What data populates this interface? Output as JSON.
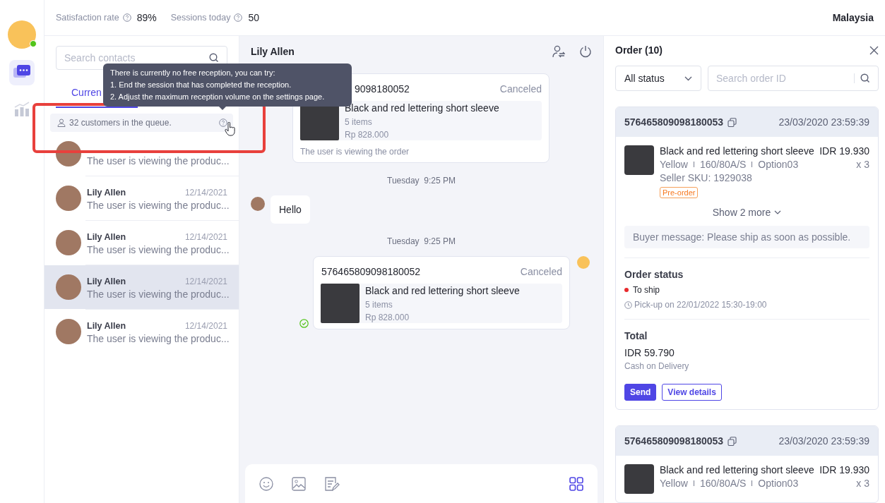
{
  "rail": {
    "agent_online": true,
    "items": [
      {
        "kind": "chat",
        "selected": true
      },
      {
        "kind": "stats",
        "selected": false
      }
    ]
  },
  "top_bar": {
    "stats": [
      {
        "label": "Satisfaction rate",
        "value": "89%"
      },
      {
        "label": "Sessions today",
        "value": "50"
      }
    ],
    "region": "Malaysia"
  },
  "contacts": {
    "search_placeholder": "Search contacts",
    "tabs": [
      {
        "label": "Curren",
        "selected": true
      }
    ],
    "queue": "32 customers in the queue.",
    "items": [
      {
        "preview": "The user is viewing the produc...",
        "selected": false
      },
      {
        "name": "Lily Allen",
        "date": "12/14/2021",
        "preview": "The user is viewing the produc...",
        "selected": false
      },
      {
        "name": "Lily Allen",
        "date": "12/14/2021",
        "preview": "The user is viewing the produc...",
        "selected": false
      },
      {
        "name": "Lily Allen",
        "date": "12/14/2021",
        "preview": "The user is viewing the produc...",
        "selected": true
      },
      {
        "name": "Lily Allen",
        "date": "12/14/2021",
        "preview": "The user is viewing the produc...",
        "selected": false
      }
    ]
  },
  "tooltip": {
    "lines": [
      "There is currently no free reception, you can try:",
      "1. End the session that has completed the reception.",
      "2. Adjust the maximum reception volume on the settings page."
    ]
  },
  "chat": {
    "title": "Lily Allen",
    "messages": [
      {
        "kind": "order-viewed",
        "order_id": "9098180052",
        "status": "Canceled",
        "product": "Black and red lettering short sleeve",
        "items": "5 items",
        "price": "Rp 828.000",
        "caption": "The user is viewing the order"
      },
      {
        "kind": "time",
        "text": "Tuesday  9:25 PM"
      },
      {
        "kind": "text",
        "text": "Hello"
      },
      {
        "kind": "time",
        "text": "Tuesday  9:25 PM"
      },
      {
        "kind": "order-sent",
        "delivered": true,
        "order_id": "576465809098180052",
        "status": "Canceled",
        "product": "Black and red lettering short sleeve",
        "items": "5 items",
        "price": "Rp 828.000"
      }
    ]
  },
  "orders": {
    "title": "Order (10)",
    "status_filter": "All status",
    "search_placeholder": "Search order ID",
    "items": [
      {
        "order_id": "576465809098180053",
        "datetime": "23/03/2020 23:59:39",
        "product": {
          "name": "Black and red lettering short sleeve",
          "price": "IDR 19.930",
          "variants": [
            "Yellow",
            "160/80A/S",
            "Option03"
          ],
          "qty": "x 3",
          "sku": "Seller SKU: 1929038",
          "tag": "Pre-order"
        },
        "more": "Show 2 more",
        "buyer_message": "Buyer message: Please ship as soon as possible.",
        "status_heading": "Order status",
        "status": {
          "label": "To ship",
          "color": "#e8292c"
        },
        "pickup": "Pick-up on 22/01/2022 15:30-19:00",
        "total_heading": "Total",
        "total": "IDR 59.790",
        "payment": "Cash on Delivery",
        "buttons": [
          "Send",
          "View details"
        ]
      },
      {
        "order_id": "576465809098180053",
        "datetime": "23/03/2020 23:59:39",
        "product": {
          "name": "Black and red lettering short sleeve",
          "price": "IDR 19.930",
          "variants": [
            "Yellow",
            "160/80A/S",
            "Option03"
          ],
          "qty": "x 3"
        }
      }
    ]
  }
}
